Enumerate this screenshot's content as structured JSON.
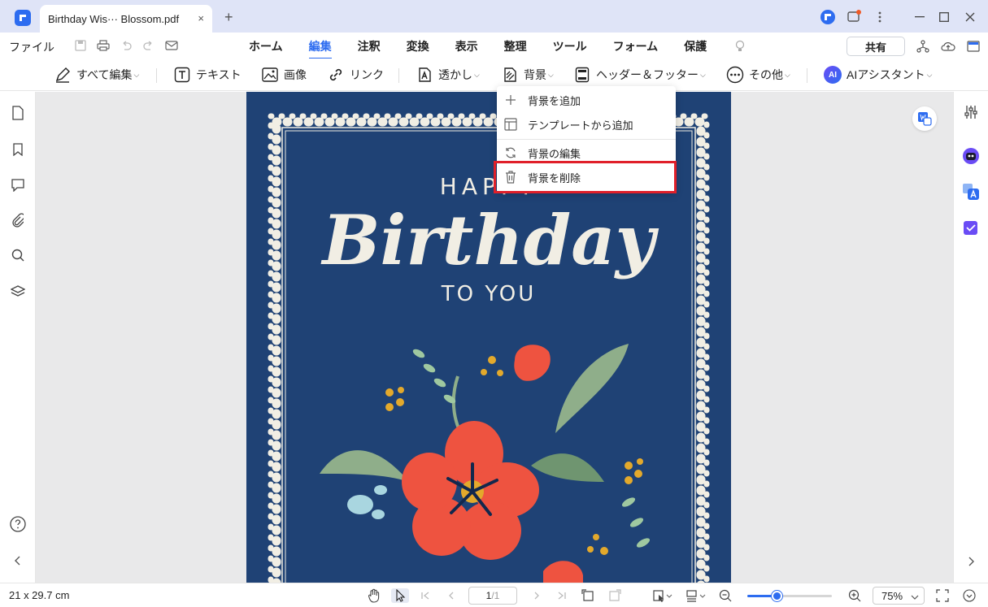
{
  "titlebar": {
    "tab_title": "Birthday  Wis··· Blossom.pdf",
    "tab_close": "×",
    "new_tab": "+"
  },
  "menu": {
    "file": "ファイル",
    "tabs": [
      "ホーム",
      "編集",
      "注釈",
      "変換",
      "表示",
      "整理",
      "ツール",
      "フォーム",
      "保護"
    ],
    "active_tab": "編集",
    "share": "共有"
  },
  "toolbar": {
    "edit_all": "すべて編集",
    "text": "テキスト",
    "image": "画像",
    "link": "リンク",
    "watermark": "透かし",
    "background": "背景",
    "header_footer": "ヘッダー＆フッター",
    "more": "その他",
    "ai_badge": "AI",
    "ai_assistant": "AIアシスタント",
    "chevron": "⌵"
  },
  "dropdown": {
    "items": [
      {
        "label": "背景を追加",
        "icon": "plus-icon"
      },
      {
        "label": "テンプレートから追加",
        "icon": "template-icon"
      },
      {
        "label": "背景の編集",
        "icon": "refresh-icon"
      },
      {
        "label": "背景を削除",
        "icon": "trash-icon"
      }
    ],
    "highlighted": "背景を削除"
  },
  "document": {
    "line1": "HAPPY",
    "line2": "Birthday",
    "line3": "TO YOU"
  },
  "statusbar": {
    "page_size": "21 x 29.7 cm",
    "current_page": "1",
    "total_pages": "/1",
    "zoom": "75%",
    "zoom_value": 0.35
  },
  "colors": {
    "accent": "#2d6cf0",
    "highlight_border": "#e0202a",
    "page_bg": "#1f4275"
  }
}
